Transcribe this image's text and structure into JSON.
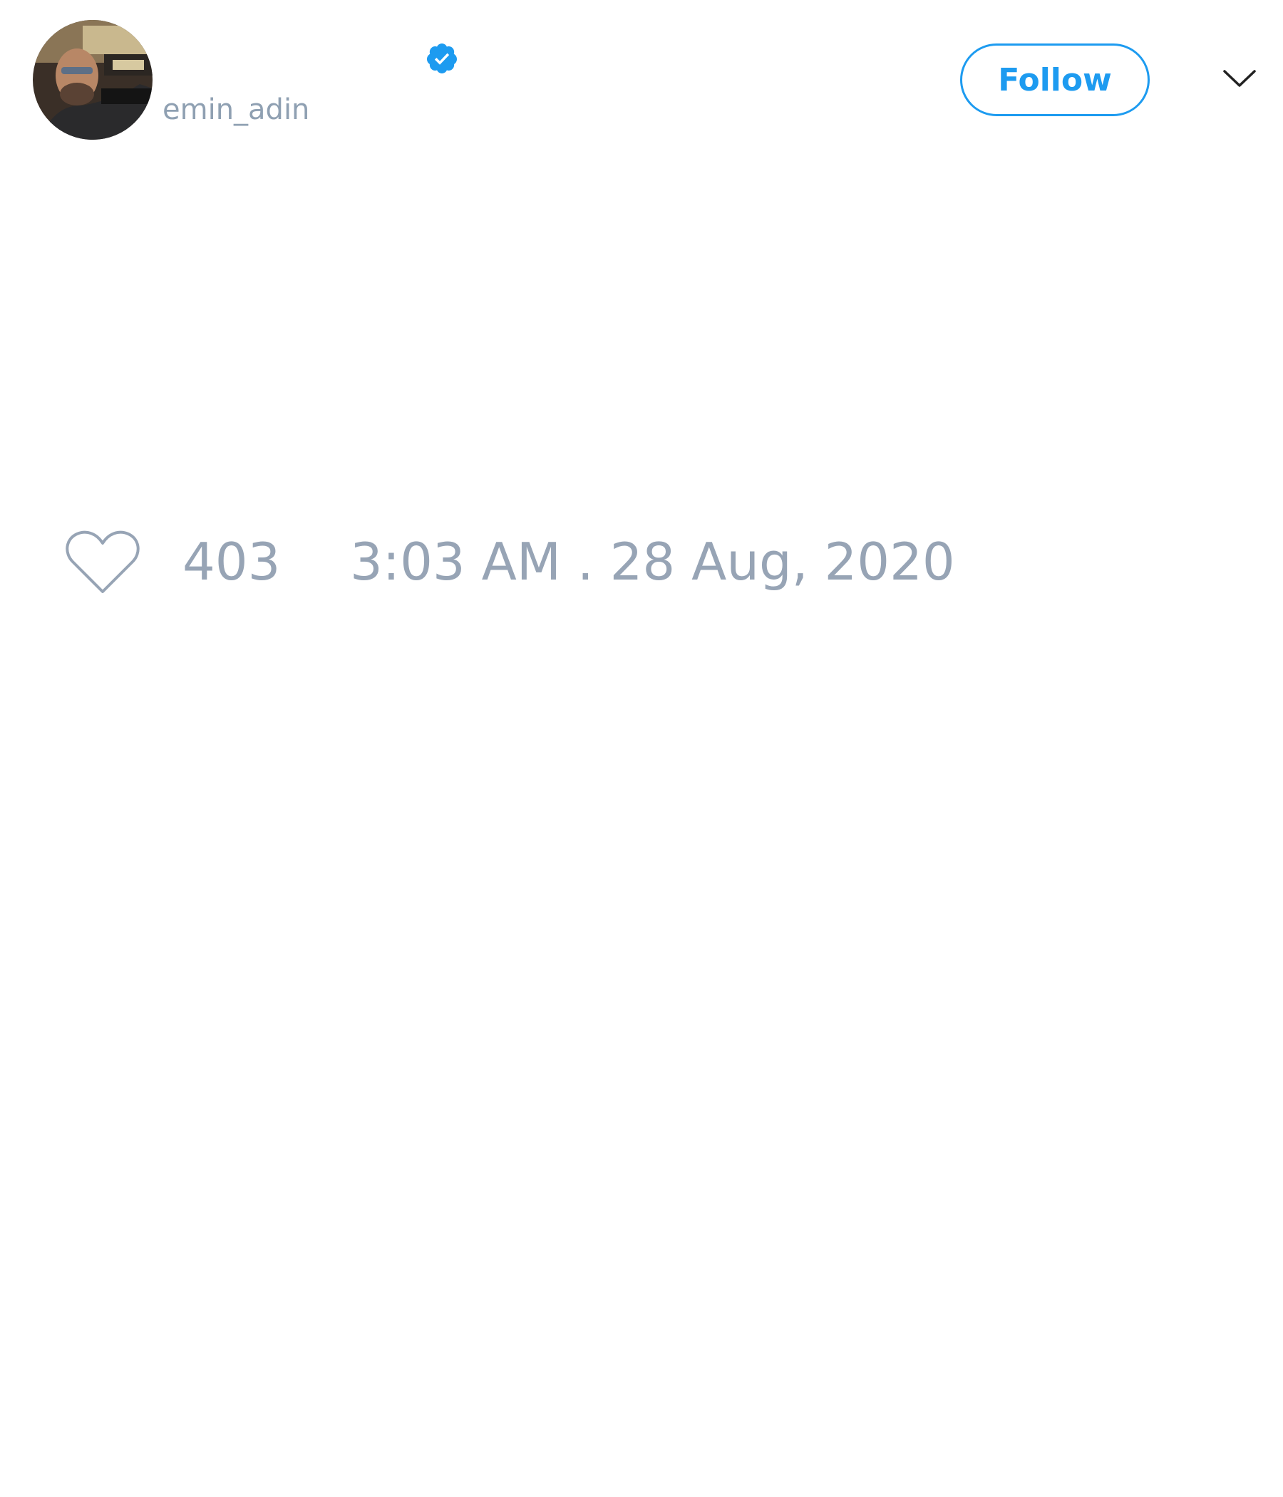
{
  "author": {
    "handle": "emin_adin",
    "verified": true
  },
  "header": {
    "follow_label": "Follow"
  },
  "engagement": {
    "like_count": "403"
  },
  "meta": {
    "timestamp": "3:03 AM . 28 Aug, 2020"
  },
  "icons": {
    "verified": "verified-badge-icon",
    "like": "heart-icon",
    "menu": "chevron-down-icon"
  },
  "colors": {
    "accent": "#1d9bf0",
    "muted_text": "#97a4b5",
    "background": "#ffffff"
  }
}
